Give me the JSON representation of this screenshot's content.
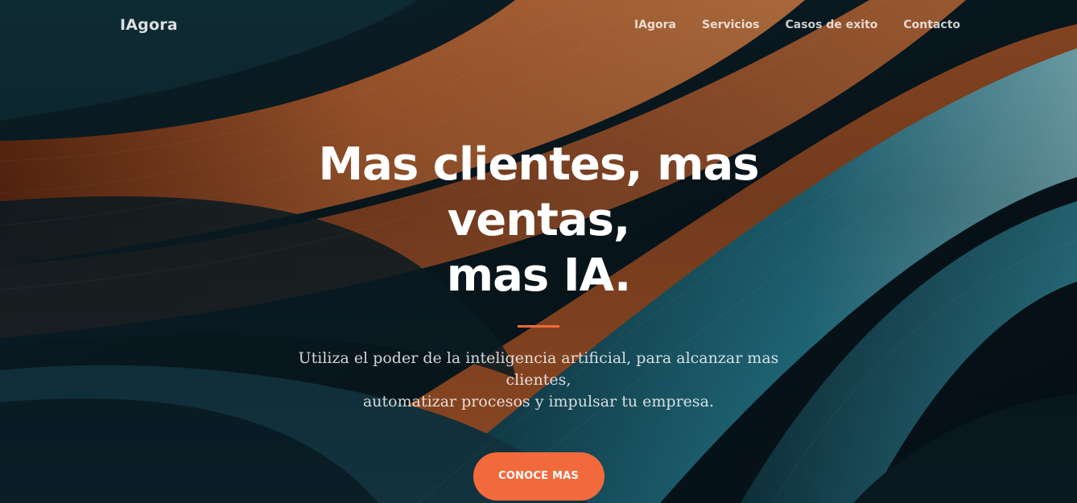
{
  "nav": {
    "brand": "IAgora",
    "links": [
      "IAgora",
      "Servicios",
      "Casos de exito",
      "Contacto"
    ]
  },
  "hero": {
    "headline_line1": "Mas clientes, mas ventas,",
    "headline_line2": "mas IA.",
    "subtitle_line1": "Utiliza el poder de la inteligencia artificial, para alcanzar mas clientes,",
    "subtitle_line2": "automatizar procesos y impulsar tu empresa.",
    "cta_label": "CONOCE MAS"
  },
  "colors": {
    "accent": "#f26a3c",
    "background_dark": "#0b1a22",
    "wave_orange": "#c4622a",
    "wave_teal": "#2f8ea3"
  }
}
